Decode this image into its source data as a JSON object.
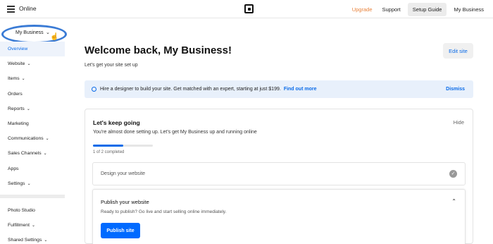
{
  "topbar": {
    "app_name": "Online",
    "links": {
      "upgrade": "Upgrade",
      "support": "Support",
      "setup_guide": "Setup Guide",
      "business": "My Business"
    },
    "icons": {
      "menu": "hamburger-icon",
      "logo": "square-logo-icon"
    }
  },
  "sidebar": {
    "business_switch": {
      "label": "My Business",
      "chevron": "chevron-down-icon"
    },
    "items": [
      {
        "label": "Overview",
        "active": true,
        "has_chevron": false
      },
      {
        "label": "Website",
        "has_chevron": true
      },
      {
        "label": "Items",
        "has_chevron": true
      },
      {
        "label": "Orders",
        "has_chevron": false
      },
      {
        "label": "Reports",
        "has_chevron": true
      },
      {
        "label": "Marketing",
        "has_chevron": false
      },
      {
        "label": "Communications",
        "has_chevron": true
      },
      {
        "label": "Sales Channels",
        "has_chevron": true
      },
      {
        "label": "Apps",
        "has_chevron": false
      },
      {
        "label": "Settings",
        "has_chevron": true
      }
    ],
    "secondary_items": [
      {
        "label": "Photo Studio",
        "has_chevron": false
      },
      {
        "label": "Fulfillment",
        "has_chevron": true
      },
      {
        "label": "Shared Settings",
        "has_chevron": true
      }
    ]
  },
  "main": {
    "title": "Welcome back, My Business!",
    "subtitle": "Let's get your site set up",
    "edit_site": "Edit site",
    "banner": {
      "text": "Hire a designer to build your site. Get matched with an expert, starting at just $199.",
      "link": "Find out more",
      "dismiss": "Dismiss"
    },
    "card": {
      "title": "Let's keep going",
      "hide": "Hide",
      "subtitle": "You're almost done setting up. Let's get My Business up and running online",
      "progress": 0.5,
      "progress_text": "1 of 2 completed",
      "steps": [
        {
          "title": "Design your website",
          "completed": true
        },
        {
          "title": "Publish your website",
          "description": "Ready to publish? Go live and start selling online immediately.",
          "button": "Publish site"
        }
      ]
    }
  },
  "colors": {
    "accent": "#006aff",
    "upgrade": "#e8823b",
    "highlight_ellipse": "#3a7bd5"
  }
}
